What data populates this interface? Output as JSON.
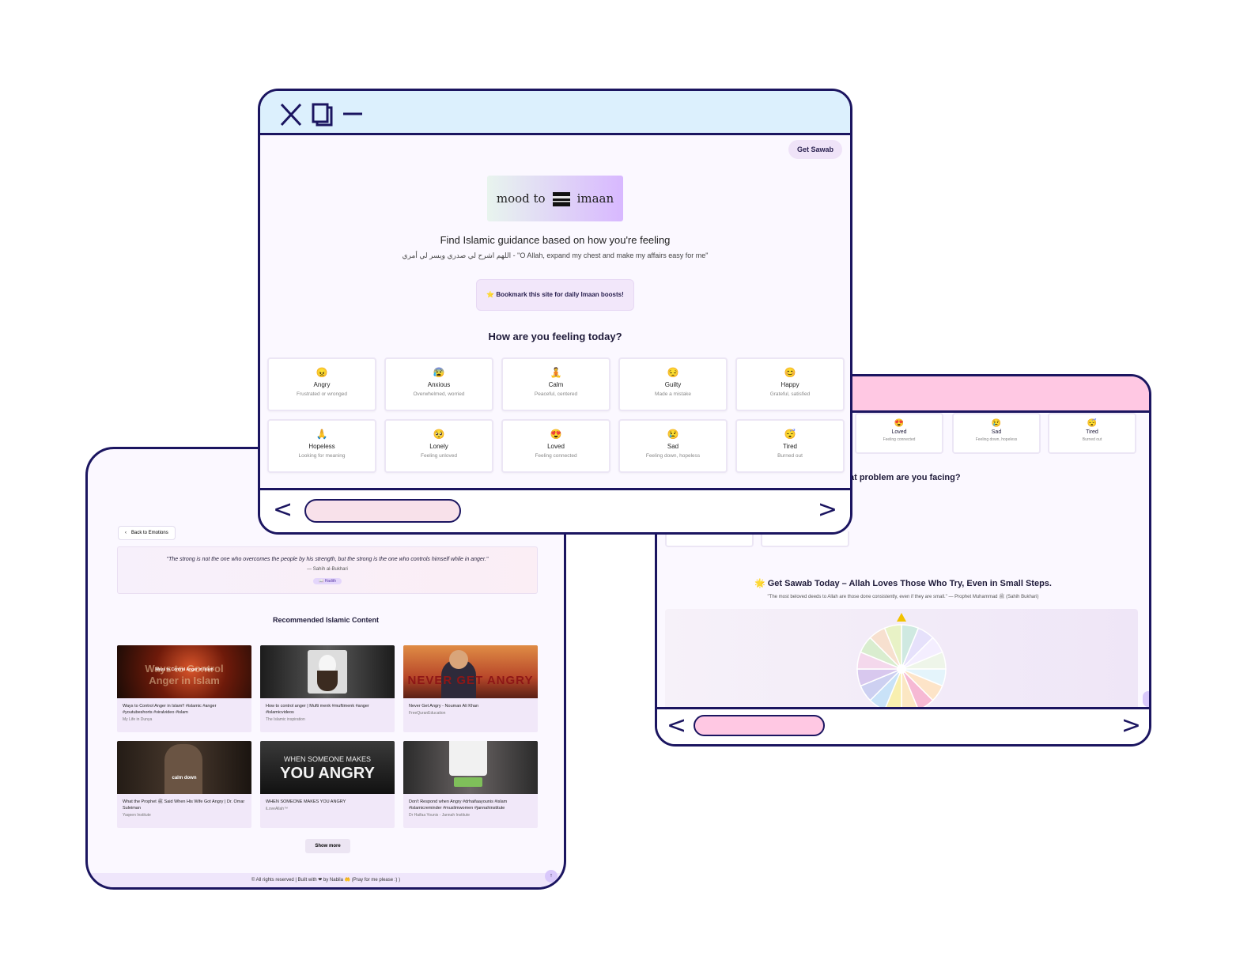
{
  "left_window": {
    "back_label": "Back to Emotions",
    "hadith": {
      "quote": "\"The strong is not the one who overcomes the people by his strength, but the strong is the one who controls himself while in anger.\"",
      "source": "— Sahih al-Bukhari",
      "tag": "Hadith"
    },
    "recommended_title": "Recommended Islamic Content",
    "videos": [
      {
        "title": "Ways to Control Anger in Islam!! #islamic #anger #youtubeshorts #viralvideo #islam",
        "channel": "My Life in Dunya",
        "thumb_text": "Ways to Control Anger in Islam"
      },
      {
        "title": "How to control anger | Mufti menk #muftimenk #anger #islamicvideos",
        "channel": "The Islamic inspiration",
        "thumb_text": ""
      },
      {
        "title": "Never Get Angry - Nouman Ali Khan",
        "channel": "FreeQuranEducation",
        "thumb_text": "NEVER GET ANGRY"
      },
      {
        "title": "What the Prophet ﷺ Said When His Wife Got Angry | Dr. Omar Suleiman",
        "channel": "Yaqeen Institute",
        "thumb_text": "calm down"
      },
      {
        "title": "WHEN SOMEONE MAKES YOU ANGRY",
        "channel": "iLoveAllah™",
        "thumb_text": "WHEN SOMEONE MAKES YOU ANGRY"
      },
      {
        "title": "Don't Respond when Angry #drhaifaayounis #islam #islamicreminder #muslimwomen #jannahinstitute",
        "channel": "Dr Haifaa Younis - Jannah Institute",
        "thumb_text": ""
      }
    ],
    "show_more": "Show more",
    "footer": "© All rights reserved | Built with ❤ by Nabila 🤲 (Pray for me please :) )"
  },
  "right_window": {
    "mini_cards": [
      {
        "emoji": "😍",
        "name": "Loved",
        "desc": "Feeling connected"
      },
      {
        "emoji": "😢",
        "name": "Sad",
        "desc": "Feeling down, hopeless"
      },
      {
        "emoji": "😴",
        "name": "Tired",
        "desc": "Burned out"
      }
    ],
    "problem_title": "at problem are you facing?",
    "sawab_title": "🌟 Get Sawab Today – Allah Loves Those Who Try, Even in Small Steps.",
    "sawab_sub": "\"The most beloved deeds to Allah are those done consistently, even if they are small.\" — Prophet Muhammad ﷺ (Sahih Bukhari)",
    "wheel_colors": [
      "#cfe9e1",
      "#e6e1fb",
      "#f4eeff",
      "#eef5e9",
      "#e4f4fb",
      "#fde4c8",
      "#f6b9d4",
      "#fbe7c3",
      "#f8efaf",
      "#c9e2f8",
      "#cdd0f1",
      "#d8c8ee",
      "#f4d8ec",
      "#d9edcf",
      "#f7e0cf",
      "#e8f2c6"
    ]
  },
  "front_window": {
    "get_sawab": "Get Sawab",
    "logo_left": "mood to",
    "logo_right": "imaan",
    "subtitle": "Find Islamic guidance based on how you're feeling",
    "dua": "اللهم اشرح لي صدري ويسر لي أمري - \"O Allah, expand my chest and make my affairs easy for me\"",
    "bookmark": "⭐ Bookmark this site for daily Imaan boosts!",
    "question": "How are you feeling today?",
    "emotions": [
      {
        "emoji": "😠",
        "name": "Angry",
        "desc": "Frustrated or wronged"
      },
      {
        "emoji": "😰",
        "name": "Anxious",
        "desc": "Overwhelmed, worried"
      },
      {
        "emoji": "🧘",
        "name": "Calm",
        "desc": "Peaceful, centered"
      },
      {
        "emoji": "😔",
        "name": "Guilty",
        "desc": "Made a mistake"
      },
      {
        "emoji": "😊",
        "name": "Happy",
        "desc": "Grateful, satisfied"
      },
      {
        "emoji": "🙏",
        "name": "Hopeless",
        "desc": "Looking for meaning"
      },
      {
        "emoji": "🥺",
        "name": "Lonely",
        "desc": "Feeling unloved"
      },
      {
        "emoji": "😍",
        "name": "Loved",
        "desc": "Feeling connected"
      },
      {
        "emoji": "😢",
        "name": "Sad",
        "desc": "Feeling down, hopeless"
      },
      {
        "emoji": "😴",
        "name": "Tired",
        "desc": "Burned out"
      }
    ]
  },
  "colors": {
    "frame": "#1b1560",
    "front_titlebar": "#dcf0fd",
    "right_titlebar": "#ffc8e3",
    "front_scroll_pill": "#f8e1ea",
    "right_scroll_pill": "#ffc8e3"
  },
  "icons": {
    "close": "close-icon",
    "restore": "restore-icon",
    "minimize": "minimize-icon",
    "prev": "chevron-left-icon",
    "next": "chevron-right-icon"
  }
}
